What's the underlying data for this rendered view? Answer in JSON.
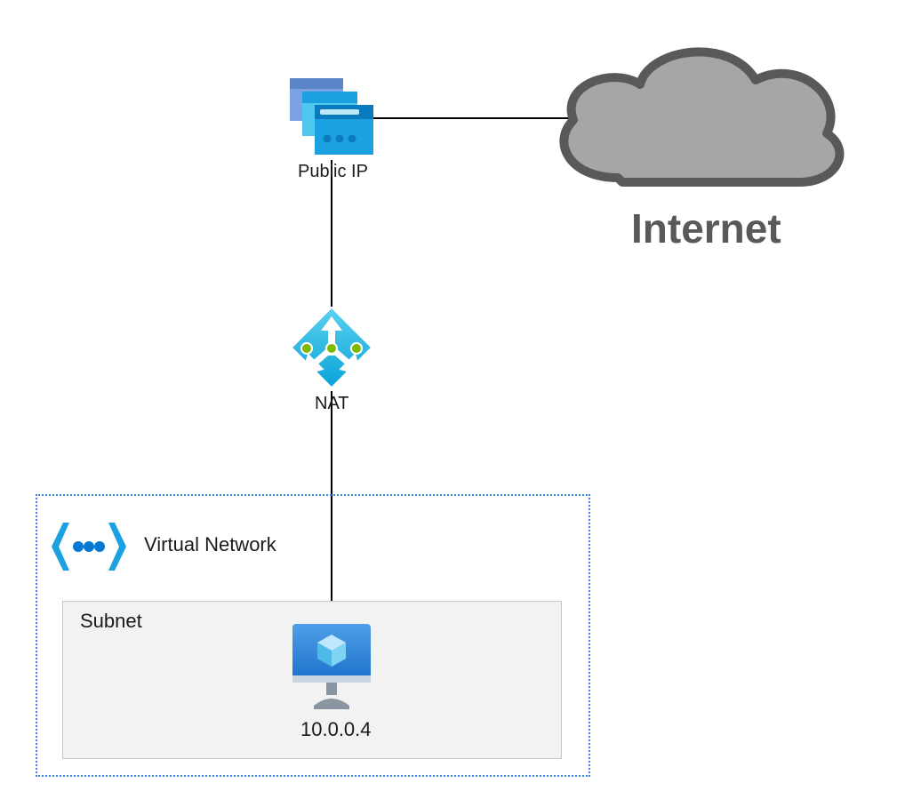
{
  "labels": {
    "public_ip": "Public IP",
    "internet": "Internet",
    "nat": "NAT",
    "virtual_network": "Virtual Network",
    "subnet": "Subnet",
    "vm_ip": "10.0.0.4"
  },
  "colors": {
    "azure_light": "#50c7ef",
    "azure_mid": "#1ba1e2",
    "azure_dark": "#0078d4",
    "azure_blue_panel": "#3597d4",
    "periwinkle": "#7aa2e0",
    "cloud_fill": "#a6a6a6",
    "cloud_stroke": "#595959",
    "green_dot": "#7fba00",
    "connector": "#000000"
  },
  "diagram": {
    "nodes": [
      {
        "id": "public_ip",
        "type": "public-ip-icon",
        "label_key": "public_ip"
      },
      {
        "id": "internet",
        "type": "cloud-icon",
        "label_key": "internet"
      },
      {
        "id": "nat",
        "type": "nat-gateway-icon",
        "label_key": "nat"
      },
      {
        "id": "vnet",
        "type": "vnet-container",
        "label_key": "virtual_network"
      },
      {
        "id": "subnet",
        "type": "subnet-container",
        "label_key": "subnet"
      },
      {
        "id": "vm",
        "type": "vm-icon",
        "label_key": "vm_ip"
      }
    ],
    "edges": [
      {
        "from": "public_ip",
        "to": "internet"
      },
      {
        "from": "public_ip",
        "to": "nat"
      },
      {
        "from": "nat",
        "to": "vm"
      }
    ]
  }
}
